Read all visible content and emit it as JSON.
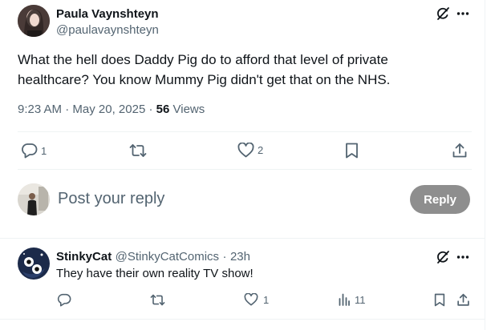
{
  "post": {
    "author_name": "Paula Vaynshteyn",
    "author_handle": "@paulavaynshteyn",
    "text": "What the hell does Daddy Pig do to afford that level of private healthcare? You know Mummy Pig didn't get that on the NHS.",
    "time": "9:23 AM",
    "separator": "·",
    "date": "May 20, 2025",
    "view_count": "56",
    "views_label": "Views",
    "actions": {
      "reply_count": "1",
      "repost_count": "",
      "like_count": "2"
    }
  },
  "composer": {
    "placeholder": "Post your reply",
    "reply_button": "Reply"
  },
  "reply": {
    "author_name": "StinkyCat",
    "author_handle": "@StinkyCatComics",
    "separator": "·",
    "time_ago": "23h",
    "text": "They have their own reality TV show!",
    "actions": {
      "reply_count": "",
      "repost_count": "",
      "like_count": "1",
      "view_count": "11"
    }
  },
  "icons": {
    "grok": "grok-icon",
    "more": "more-icon",
    "reply": "reply-icon",
    "repost": "repost-icon",
    "like": "heart-icon",
    "bookmark": "bookmark-icon",
    "share": "share-icon",
    "analytics": "analytics-icon"
  },
  "colors": {
    "text": "#0f1419",
    "secondary": "#536471",
    "divider": "#eff3f4",
    "reply_button_disabled": "#8e8e8e"
  }
}
